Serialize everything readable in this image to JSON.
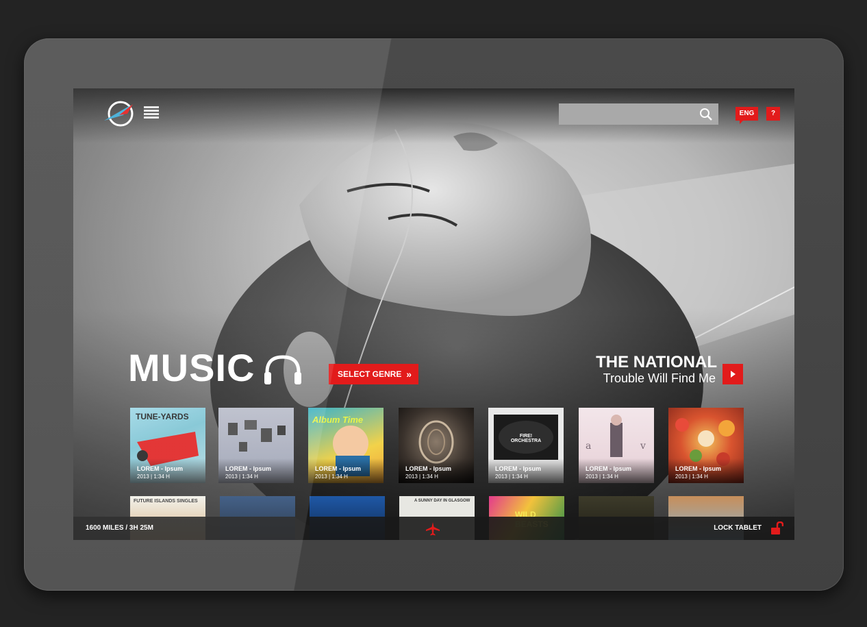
{
  "header": {
    "search_placeholder": "",
    "language": "ENG",
    "help": "?"
  },
  "hero": {
    "title": "MUSIC",
    "genre_button": "SELECT GENRE",
    "now_playing_artist": "THE NATIONAL",
    "now_playing_album": "Trouble Will Find Me"
  },
  "albums_row1": [
    {
      "title": "LOREM - Ipsum",
      "info": "2013 | 1:34 H",
      "cover_text": "TUNE-YARDS"
    },
    {
      "title": "LOREM - Ipsum",
      "info": "2013 | 1:34 H",
      "cover_text": ""
    },
    {
      "title": "LOREM - Ipsum",
      "info": "2013 | 1:34 H",
      "cover_text": "Album Time"
    },
    {
      "title": "LOREM - Ipsum",
      "info": "2013 | 1:34 H",
      "cover_text": ""
    },
    {
      "title": "LOREM - Ipsum",
      "info": "2013 | 1:34 H",
      "cover_text": "FIRE! ORCHESTRA"
    },
    {
      "title": "LOREM - Ipsum",
      "info": "2013 | 1:34 H",
      "cover_text": ""
    },
    {
      "title": "LOREM - Ipsum",
      "info": "2013 | 1:34 H",
      "cover_text": ""
    }
  ],
  "albums_row2": [
    {
      "cover_text": "FUTURE ISLANDS  SINGLES"
    },
    {
      "cover_text": ""
    },
    {
      "cover_text": ""
    },
    {
      "cover_text": "A SUNNY DAY IN GLASGOW"
    },
    {
      "cover_text": "WILD BEASTS"
    },
    {
      "cover_text": ""
    },
    {
      "cover_text": ""
    }
  ],
  "status": {
    "flight_info": "1600 MILES / 3H 25M",
    "lock_label": "LOCK TABLET"
  },
  "colors": {
    "accent": "#e21b1b",
    "logo_blue": "#3aa9d6"
  },
  "icons": {
    "logo": "airline-logo-icon",
    "menu": "hamburger-menu-icon",
    "search": "search-icon",
    "headphones": "headphones-icon",
    "play": "play-icon",
    "plane": "airplane-icon",
    "lock": "unlock-icon"
  }
}
